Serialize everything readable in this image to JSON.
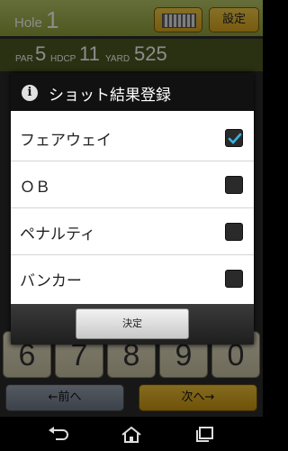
{
  "header": {
    "hole_label": "Hole",
    "hole_number": "1",
    "settings_label": "設定"
  },
  "info": {
    "par_label": "PAR",
    "par_value": "5",
    "hdcp_label": "HDCP",
    "hdcp_value": "11",
    "yard_label": "YARD",
    "yard_value": "525"
  },
  "keypad": {
    "bottom_keys": [
      "6",
      "7",
      "8",
      "9",
      "0"
    ],
    "prev_label": "←前へ",
    "next_label": "次へ→"
  },
  "dialog": {
    "title": "ショット結果登録",
    "options": [
      {
        "label": "フェアウェイ",
        "checked": true
      },
      {
        "label": "ＯＢ",
        "checked": false
      },
      {
        "label": "ペナルティ",
        "checked": false
      },
      {
        "label": "バンカー",
        "checked": false
      }
    ],
    "ok_label": "決定"
  },
  "colors": {
    "header_green": "#9aad45",
    "info_green": "#4e5a21",
    "accent_gold": "#e0b22a",
    "check_blue": "#33b5e5"
  },
  "icons": {
    "info": "info-icon",
    "grid": "grid-icon",
    "back": "back-icon",
    "home": "home-icon",
    "recents": "recents-icon"
  }
}
